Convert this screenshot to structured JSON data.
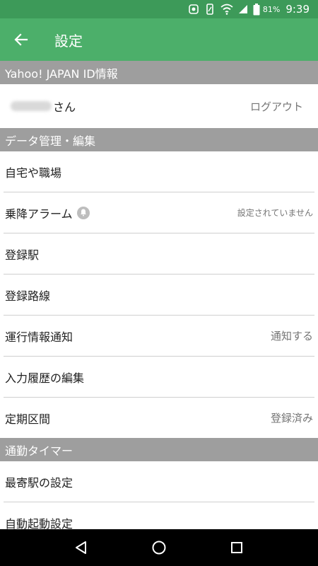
{
  "status_bar": {
    "battery_percent": "81%",
    "time": "9:39"
  },
  "app_bar": {
    "title": "設定"
  },
  "sections": {
    "yahoo_id": {
      "header": "Yahoo! JAPAN ID情報",
      "account_suffix": "さん",
      "logout_label": "ログアウト"
    },
    "data_management": {
      "header": "データ管理・編集",
      "items": [
        {
          "label": "自宅や職場",
          "value": ""
        },
        {
          "label": "乗降アラーム",
          "value": "設定されていません"
        },
        {
          "label": "登録駅",
          "value": ""
        },
        {
          "label": "登録路線",
          "value": ""
        },
        {
          "label": "運行情報通知",
          "value": "通知する"
        },
        {
          "label": "入力履歴の編集",
          "value": ""
        },
        {
          "label": "定期区間",
          "value": "登録済み"
        }
      ]
    },
    "commute_timer": {
      "header": "通勤タイマー",
      "items": [
        {
          "label": "最寄駅の設定",
          "value": ""
        },
        {
          "label": "自動起動設定",
          "value": ""
        }
      ]
    }
  },
  "icons": {
    "back": "arrow-left-icon",
    "bell": "bell-icon",
    "nav_back": "triangle-back-icon",
    "nav_home": "circle-home-icon",
    "nav_recents": "square-recents-icon"
  },
  "colors": {
    "status_bar": "#3d9a59",
    "app_bar": "#4caf6a",
    "section_header": "#9e9e9e",
    "nav_bar": "#000000"
  }
}
